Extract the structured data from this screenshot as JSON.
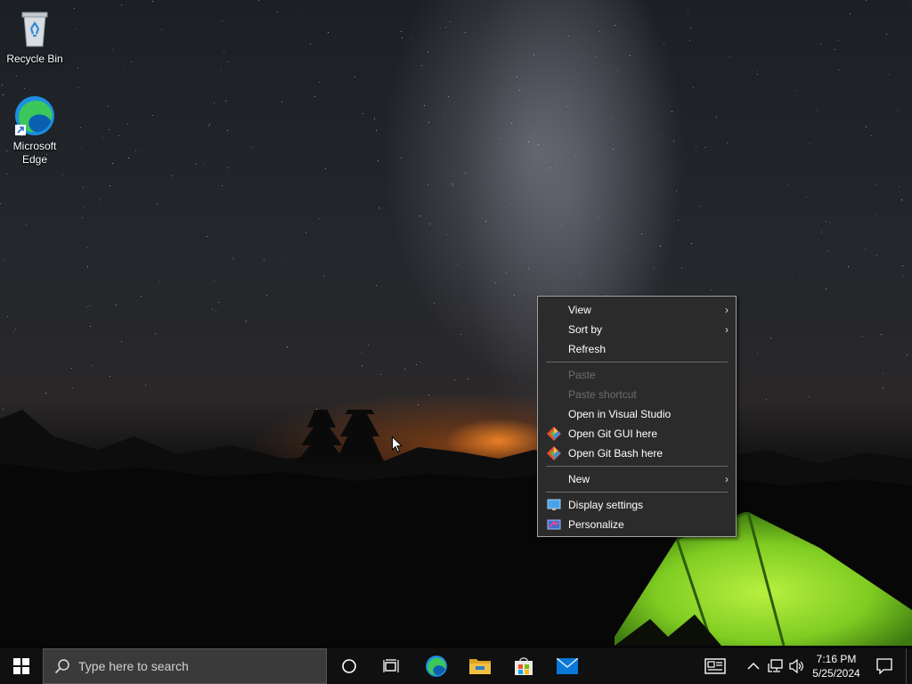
{
  "desktop": {
    "icons": [
      {
        "label": "Recycle Bin",
        "icon": "recycle-bin-icon"
      },
      {
        "label": "Microsoft Edge",
        "icon": "edge-icon"
      }
    ]
  },
  "context_menu": {
    "items": [
      {
        "label": "View",
        "has_submenu": true,
        "enabled": true
      },
      {
        "label": "Sort by",
        "has_submenu": true,
        "enabled": true
      },
      {
        "label": "Refresh",
        "has_submenu": false,
        "enabled": true
      },
      {
        "label": "Paste",
        "has_submenu": false,
        "enabled": false
      },
      {
        "label": "Paste shortcut",
        "has_submenu": false,
        "enabled": false
      },
      {
        "label": "Open in Visual Studio",
        "has_submenu": false,
        "enabled": true
      },
      {
        "label": "Open Git GUI here",
        "has_submenu": false,
        "enabled": true,
        "icon": "git-icon"
      },
      {
        "label": "Open Git Bash here",
        "has_submenu": false,
        "enabled": true,
        "icon": "git-icon"
      },
      {
        "label": "New",
        "has_submenu": true,
        "enabled": true
      },
      {
        "label": "Display settings",
        "has_submenu": false,
        "enabled": true,
        "icon": "display-icon"
      },
      {
        "label": "Personalize",
        "has_submenu": false,
        "enabled": true,
        "icon": "personalize-icon"
      }
    ],
    "submenu_glyph": "›"
  },
  "taskbar": {
    "search_placeholder": "Type here to search",
    "pinned": [
      "edge-icon",
      "file-explorer-icon",
      "store-icon",
      "mail-icon"
    ],
    "clock": {
      "time": "7:16 PM",
      "date": "5/25/2024"
    }
  },
  "colors": {
    "menu_bg": "#2b2b2b",
    "taskbar_bg": "#101010",
    "edge_blue": "#1b8fe0",
    "edge_green": "#3cc75b",
    "folder_yellow": "#f0c040",
    "mail_blue": "#0a78d7"
  }
}
